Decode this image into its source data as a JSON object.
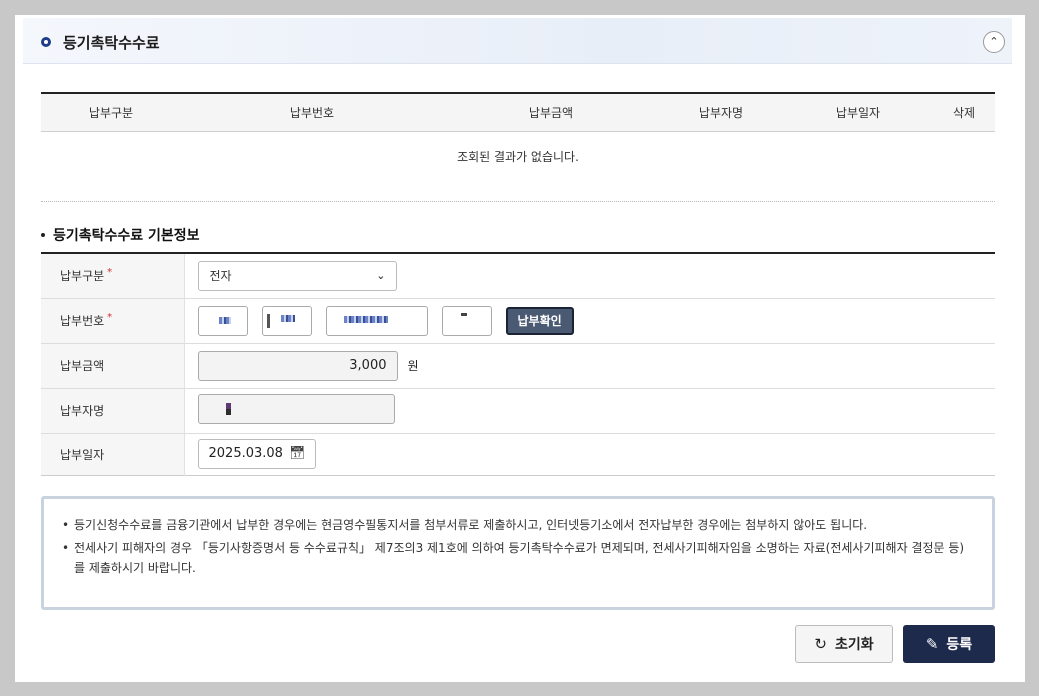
{
  "section": {
    "title": "등기촉탁수수료",
    "collapse_icon": "chevron-up-icon"
  },
  "list_table": {
    "columns": [
      "납부구분",
      "납부번호",
      "납부금액",
      "납부자명",
      "납부일자",
      "삭제"
    ],
    "empty_message": "조회된 결과가 없습니다."
  },
  "basic_info": {
    "title": "등기촉탁수수료 기본정보",
    "rows": {
      "payment_type": {
        "label": "납부구분",
        "required": "*",
        "value": "전자"
      },
      "payment_number": {
        "label": "납부번호",
        "required": "*",
        "confirm_label": "납부확인"
      },
      "payment_amount": {
        "label": "납부금액",
        "value": "3,000",
        "unit": "원"
      },
      "payer_name": {
        "label": "납부자명"
      },
      "payment_date": {
        "label": "납부일자",
        "value": "2025.03.08",
        "icon": "calendar-icon"
      }
    }
  },
  "notices": [
    "등기신청수수료를 금융기관에서 납부한 경우에는 현금영수필통지서를 첨부서류로 제출하시고, 인터넷등기소에서 전자납부한 경우에는 첨부하지 않아도 됩니다.",
    "전세사기 피해자의 경우 「등기사항증명서 등 수수료규칙」 제7조의3 제1호에 의하여 등기촉탁수수료가 면제되며, 전세사기피해자임을 소명하는 자료(전세사기피해자 결정문 등)를 제출하시기 바랍니다."
  ],
  "buttons": {
    "reset_label": "초기화",
    "reset_icon": "refresh-icon",
    "save_label": "등록",
    "save_icon": "pencil-icon"
  },
  "colors": {
    "header_bullet": "#1f3d8a",
    "save_button": "#1e2a4c",
    "confirm_button": "#4b5a73",
    "required_mark": "#d32f2f"
  }
}
